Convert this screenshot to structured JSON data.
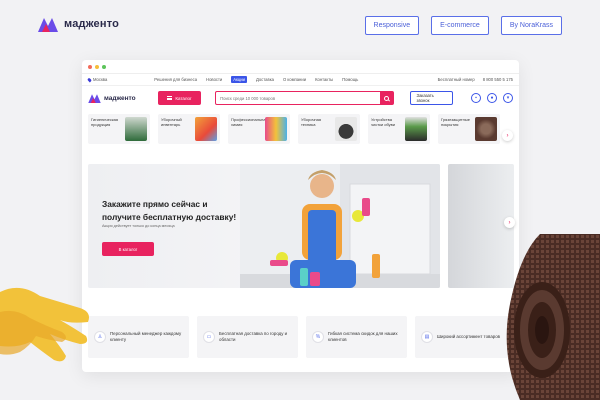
{
  "brand": {
    "name": "мадженто",
    "colors": {
      "accent": "#e8235f",
      "primary": "#3b55e8",
      "logo_a": "#e8235f",
      "logo_b": "#6a4be8"
    }
  },
  "tags": [
    "Responsive",
    "E-commerce",
    "By NoraKrass"
  ],
  "topnav": {
    "city": "Москва",
    "links": [
      "Решения для бизнеса",
      "Новости",
      "Акции",
      "Доставка",
      "О компании",
      "Контакты",
      "Помощь"
    ],
    "active_link": "Акции",
    "free_number_label": "Бесплатный номер",
    "phone": "8 800 550 5 175"
  },
  "header": {
    "catalog_label": "Каталог",
    "search_placeholder": "Поиск среди 10 000 товаров",
    "call_label": "Заказать звонок",
    "icons": [
      "chart-icon",
      "user-icon",
      "cart-icon"
    ]
  },
  "categories": [
    {
      "label": "Гигиеническая продукция",
      "color": "#2e6b3a"
    },
    {
      "label": "Уборочный инвентарь",
      "color": "#f2a23a"
    },
    {
      "label": "Профессиональная химия",
      "color": "#e94a8a"
    },
    {
      "label": "Уборочная техника",
      "color": "#3a3a3a"
    },
    {
      "label": "Устройства чистки обуви",
      "color": "#5a9a4a"
    },
    {
      "label": "Грязезащитные покрытия",
      "color": "#5a3a30"
    }
  ],
  "hero": {
    "title_line1": "Закажите прямо сейчас и",
    "title_line2": "получите бесплатную доставку!",
    "subtitle": "Акция действует только до конца месяца",
    "cta": "В каталог"
  },
  "features": [
    {
      "icon": "manager-icon",
      "label": "Персональный менеджер каждому клиенту"
    },
    {
      "icon": "delivery-icon",
      "label": "Бесплатная доставка по городу и области"
    },
    {
      "icon": "discount-icon",
      "label": "Гибкая система скидок для наших клиентов"
    },
    {
      "icon": "assortment-icon",
      "label": "Широкий ассортимент товаров"
    }
  ]
}
